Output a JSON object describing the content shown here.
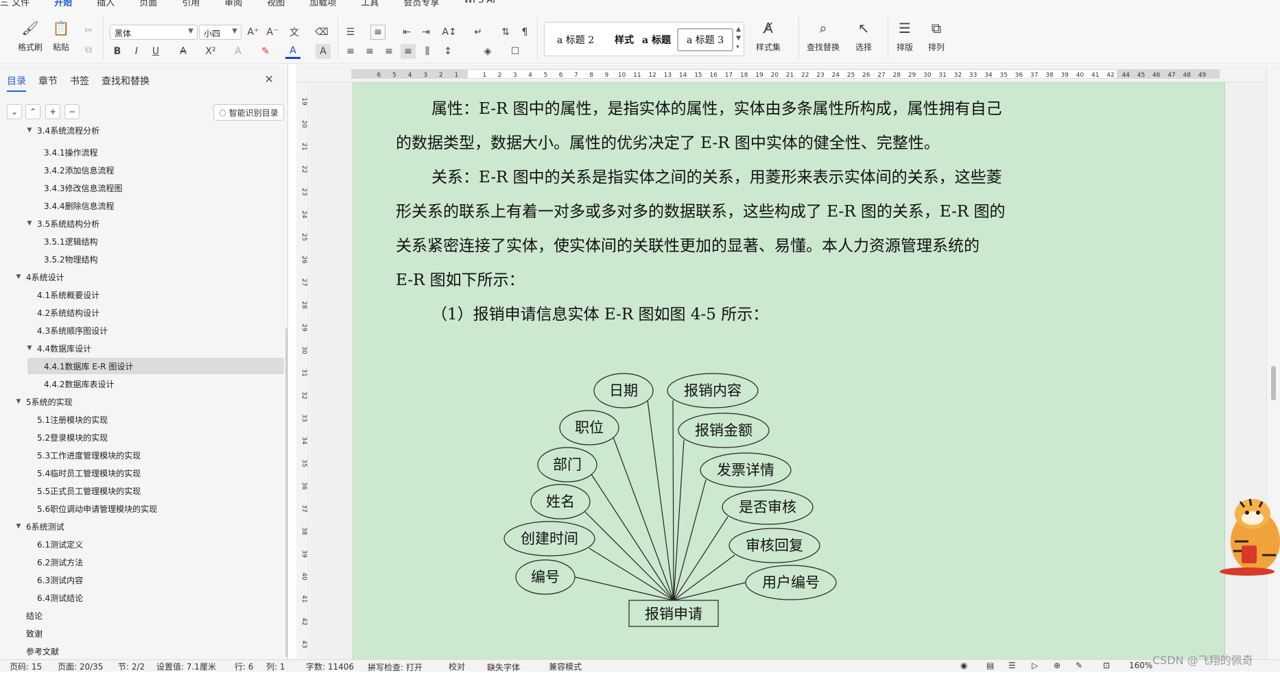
{
  "menu": {
    "tabs": [
      "三 文件",
      "开始",
      "插入",
      "页面",
      "引用",
      "审阅",
      "视图",
      "加载项",
      "工具",
      "会员专享",
      "WPS AI"
    ],
    "active_tab": "开始"
  },
  "ribbon": {
    "format_painter": "格式刷",
    "paste": "粘贴",
    "font_name": "黑体",
    "font_size": "小四",
    "styles": {
      "heading2": "a 标题 2",
      "style_label": "样式",
      "heading_default": "a 标题",
      "heading3": "a 标题 3"
    },
    "style_set": "样式集",
    "find_replace": "查找替换",
    "select": "选择",
    "layout": "排版",
    "arrange": "排列"
  },
  "nav": {
    "tabs": [
      "目录",
      "章节",
      "书签",
      "查找和替换"
    ],
    "active_tab": "目录",
    "smart_button": "智能识别目录",
    "items": [
      {
        "label": "3.4系统流程分析",
        "level": 2,
        "expanded": true
      },
      {
        "label": "3.4.1操作流程",
        "level": 3
      },
      {
        "label": "3.4.2添加信息流程",
        "level": 3
      },
      {
        "label": "3.4.3修改信息流程图",
        "level": 3
      },
      {
        "label": "3.4.4删除信息流程",
        "level": 3
      },
      {
        "label": "3.5系统结构分析",
        "level": 2,
        "expanded": true
      },
      {
        "label": "3.5.1逻辑结构",
        "level": 3
      },
      {
        "label": "3.5.2物理结构",
        "level": 3
      },
      {
        "label": "4系统设计",
        "level": 1,
        "expanded": true
      },
      {
        "label": "4.1系统概要设计",
        "level": 2
      },
      {
        "label": "4.2系统结构设计",
        "level": 2
      },
      {
        "label": "4.3系统顺序图设计",
        "level": 2
      },
      {
        "label": "4.4数据库设计",
        "level": 2,
        "expanded": true
      },
      {
        "label": "4.4.1数据库 E-R 图设计",
        "level": 3,
        "active": true
      },
      {
        "label": "4.4.2数据库表设计",
        "level": 3
      },
      {
        "label": "5系统的实现",
        "level": 1,
        "expanded": true
      },
      {
        "label": "5.1注册模块的实现",
        "level": 2
      },
      {
        "label": "5.2登录模块的实现",
        "level": 2
      },
      {
        "label": "5.3工作进度管理模块的实现",
        "level": 2
      },
      {
        "label": "5.4临时员工管理模块的实现",
        "level": 2
      },
      {
        "label": "5.5正式员工管理模块的实现",
        "level": 2
      },
      {
        "label": "5.6职位调动申请管理模块的实现",
        "level": 2
      },
      {
        "label": "6系统测试",
        "level": 1,
        "expanded": true
      },
      {
        "label": "6.1测试定义",
        "level": 2
      },
      {
        "label": "6.2测试方法",
        "level": 2
      },
      {
        "label": "6.3测试内容",
        "level": 2
      },
      {
        "label": "6.4测试结论",
        "level": 2
      },
      {
        "label": "结论",
        "level": 1
      },
      {
        "label": "致谢",
        "level": 1
      },
      {
        "label": "参考文献",
        "level": 1
      }
    ]
  },
  "ruler": {
    "h_left": [
      "6",
      "5",
      "4",
      "3",
      "2",
      "1"
    ],
    "h_right": [
      "1",
      "2",
      "3",
      "4",
      "5",
      "6",
      "7",
      "8",
      "9",
      "10",
      "11",
      "12",
      "13",
      "14",
      "15",
      "16",
      "17",
      "18",
      "19",
      "20",
      "21",
      "22",
      "23",
      "24",
      "25",
      "26",
      "27",
      "28",
      "29",
      "30",
      "31",
      "32",
      "33",
      "34",
      "35",
      "36",
      "37",
      "38",
      "39",
      "40",
      "41",
      "42",
      "44",
      "45",
      "46",
      "47",
      "48",
      "49"
    ],
    "v": [
      "19",
      "20",
      "21",
      "22",
      "23",
      "24",
      "25",
      "26",
      "27",
      "28",
      "29",
      "30",
      "31",
      "32",
      "33",
      "34",
      "35",
      "36",
      "37",
      "38",
      "39",
      "40",
      "41",
      "42",
      "43"
    ]
  },
  "document": {
    "lines": [
      "属性：E-R 图中的属性，是指实体的属性，实体由多条属性所构成，属性拥有自己",
      "的数据类型，数据大小。属性的优劣决定了 E-R 图中实体的健全性、完整性。",
      "关系：E-R 图中的关系是指实体之间的关系，用菱形来表示实体间的关系，这些菱",
      "形关系的联系上有着一对多或多对多的数据联系，这些构成了 E-R 图的关系，E-R 图的",
      "关系紧密连接了实体，使实体间的关联性更加的显著、易懂。本人力资源管理系统的",
      "E-R 图如下所示：",
      "（1）报销申请信息实体 E-R 图如图 4-5 所示："
    ]
  },
  "er_diagram": {
    "entity": "报销申请",
    "attributes": [
      "日期",
      "报销内容",
      "职位",
      "报销金额",
      "部门",
      "发票详情",
      "姓名",
      "是否审核",
      "创建时间",
      "审核回复",
      "编号",
      "用户编号"
    ]
  },
  "statusbar": {
    "page": "页码: 15",
    "pages": "页面: 20/35",
    "section": "节: 2/2",
    "setting": "设置值: 7.1厘米",
    "row": "行: 6",
    "col": "列: 1",
    "words": "字数: 11406",
    "spell": "拼写检查: 打开",
    "proof": "校对",
    "missing_font": "缺失字体",
    "compat": "兼容模式",
    "zoom": "160%"
  },
  "watermark": "CSDN @飞翔的佩奇",
  "colors": {
    "page_bg": "#cce8cf",
    "accent": "#1f5fd8"
  }
}
